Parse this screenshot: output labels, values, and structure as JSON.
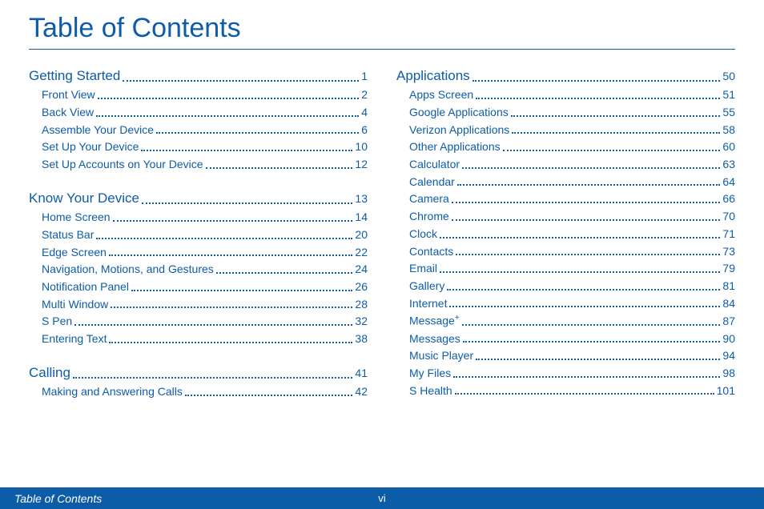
{
  "title": "Table of Contents",
  "footer": {
    "label": "Table of Contents",
    "page": "vi"
  },
  "leftSections": [
    {
      "head": {
        "label": "Getting Started",
        "page": "1"
      },
      "items": [
        {
          "label": "Front View",
          "page": "2"
        },
        {
          "label": "Back View",
          "page": "4"
        },
        {
          "label": "Assemble Your Device",
          "page": "6"
        },
        {
          "label": "Set Up Your Device",
          "page": "10"
        },
        {
          "label": "Set Up Accounts on Your Device",
          "page": "12"
        }
      ]
    },
    {
      "head": {
        "label": "Know Your Device",
        "page": "13"
      },
      "items": [
        {
          "label": "Home Screen",
          "page": "14"
        },
        {
          "label": "Status Bar",
          "page": "20"
        },
        {
          "label": "Edge Screen",
          "page": "22"
        },
        {
          "label": "Navigation, Motions, and Gestures",
          "page": "24"
        },
        {
          "label": "Notification Panel",
          "page": "26"
        },
        {
          "label": "Multi Window",
          "page": "28"
        },
        {
          "label": "S Pen",
          "page": "32"
        },
        {
          "label": "Entering Text",
          "page": "38"
        }
      ]
    },
    {
      "head": {
        "label": "Calling",
        "page": "41"
      },
      "items": [
        {
          "label": "Making and Answering Calls",
          "page": "42"
        }
      ]
    }
  ],
  "rightSections": [
    {
      "head": {
        "label": "Applications",
        "page": "50"
      },
      "items": [
        {
          "label": "Apps Screen",
          "page": "51"
        },
        {
          "label": "Google Applications",
          "page": "55"
        },
        {
          "label": "Verizon Applications",
          "page": "58"
        },
        {
          "label": "Other Applications",
          "page": "60"
        },
        {
          "label": "Calculator",
          "page": "63"
        },
        {
          "label": "Calendar",
          "page": "64"
        },
        {
          "label": "Camera",
          "page": "66"
        },
        {
          "label": "Chrome",
          "page": "70"
        },
        {
          "label": "Clock",
          "page": "71"
        },
        {
          "label": "Contacts",
          "page": "73"
        },
        {
          "label": "Email",
          "page": "79"
        },
        {
          "label": "Gallery",
          "page": "81"
        },
        {
          "label": "Internet",
          "page": "84"
        },
        {
          "label": "Message+",
          "page": "87"
        },
        {
          "label": "Messages",
          "page": "90"
        },
        {
          "label": "Music Player",
          "page": "94"
        },
        {
          "label": "My Files",
          "page": "98"
        },
        {
          "label": "S Health",
          "page": "101"
        }
      ]
    }
  ]
}
